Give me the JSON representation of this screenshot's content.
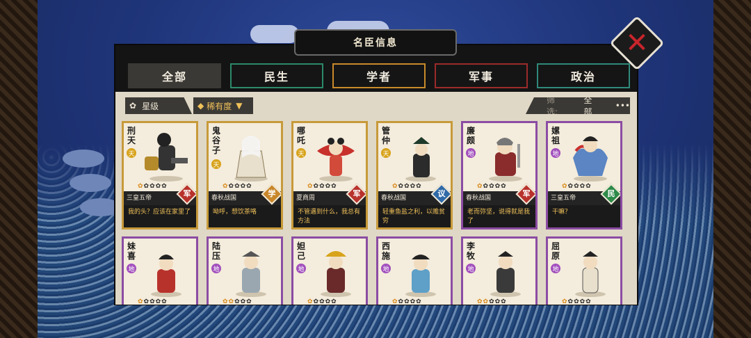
{
  "title": "名臣信息",
  "tabs": [
    {
      "label": "全部"
    },
    {
      "label": "民生"
    },
    {
      "label": "学者"
    },
    {
      "label": "军事"
    },
    {
      "label": "政治"
    }
  ],
  "filters": {
    "star_label": "星级",
    "rarity_label": "稀有度",
    "screen_label": "筛选:",
    "screen_value": "全部",
    "more": "•••"
  },
  "cards": [
    {
      "name": "刑天",
      "grade": "天",
      "stars_on": 1,
      "era": "三皇五帝",
      "role": "军",
      "quote": "我的头？应该在家里了"
    },
    {
      "name": "鬼谷子",
      "grade": "天",
      "stars_on": 1,
      "era": "春秋战国",
      "role": "学",
      "quote": "呦呼，想饮茶咯"
    },
    {
      "name": "哪吒",
      "grade": "天",
      "stars_on": 1,
      "era": "夏商周",
      "role": "军",
      "quote": "不管遇到什么，我总有方法"
    },
    {
      "name": "管仲",
      "grade": "天",
      "stars_on": 1,
      "era": "春秋战国",
      "role": "议",
      "quote": "轻重鱼盐之利，以赡贫穷"
    },
    {
      "name": "廉颇",
      "grade": "地",
      "stars_on": 1,
      "era": "春秋战国",
      "role": "军",
      "quote": "老而弥坚，说得就是我了"
    },
    {
      "name": "嫘祖",
      "grade": "地",
      "stars_on": 1,
      "era": "三皇五帝",
      "role": "民",
      "quote": "干嘛？"
    },
    {
      "name": "妹喜",
      "grade": "地",
      "stars_on": 1
    },
    {
      "name": "陆压",
      "grade": "地",
      "stars_on": 2
    },
    {
      "name": "妲己",
      "grade": "地",
      "stars_on": 1
    },
    {
      "name": "西施",
      "grade": "地",
      "stars_on": 1
    },
    {
      "name": "李牧",
      "grade": "地",
      "stars_on": 2
    },
    {
      "name": "屈原",
      "grade": "地",
      "stars_on": 1
    }
  ],
  "colors": {
    "gold_border": "#c79a3a",
    "purple_border": "#8b4ca3",
    "close_red": "#c8252b"
  }
}
